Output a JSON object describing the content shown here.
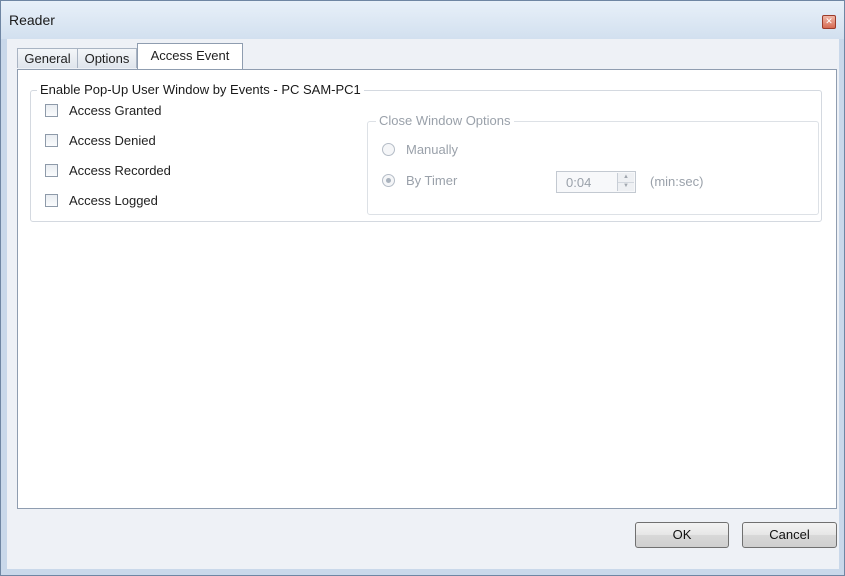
{
  "window": {
    "title": "Reader"
  },
  "tabs": [
    {
      "label": "General"
    },
    {
      "label": "Options"
    },
    {
      "label": "Access Event"
    }
  ],
  "events_group": {
    "title": "Enable Pop-Up User Window by Events - PC SAM-PC1",
    "checkboxes": [
      {
        "label": "Access Granted",
        "checked": false
      },
      {
        "label": "Access Denied",
        "checked": false
      },
      {
        "label": "Access Recorded",
        "checked": false
      },
      {
        "label": "Access Logged",
        "checked": false
      }
    ]
  },
  "close_options": {
    "title": "Close Window Options",
    "manually_label": "Manually",
    "by_timer_label": "By Timer",
    "selected": "By Timer",
    "timer_value": "0:04",
    "timer_unit": "(min:sec)"
  },
  "buttons": {
    "ok": "OK",
    "cancel": "Cancel"
  }
}
